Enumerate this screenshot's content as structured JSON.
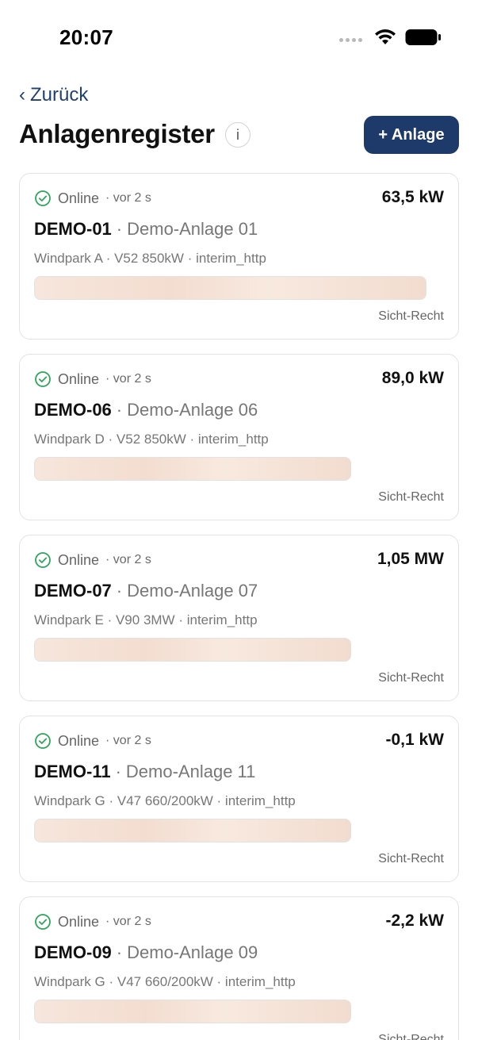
{
  "statusbar": {
    "time": "20:07"
  },
  "nav": {
    "back_label": "Zurück"
  },
  "header": {
    "title": "Anlagenregister",
    "info_label": "i",
    "add_label": "+ Anlage"
  },
  "colors": {
    "accent": "#1d3a6b",
    "back_link": "#1f3f76",
    "online_green": "#2fa55a"
  },
  "plants": [
    {
      "status": "Online",
      "age": "· vor 2 s",
      "power": "63,5 kW",
      "id": "DEMO-01",
      "sep": "·",
      "name": "Demo-Anlage 01",
      "meta": "Windpark A · V52 850kW · interim_http",
      "rights": "Sicht-Recht"
    },
    {
      "status": "Online",
      "age": "· vor 2 s",
      "power": "89,0 kW",
      "id": "DEMO-06",
      "sep": "·",
      "name": "Demo-Anlage 06",
      "meta": "Windpark D · V52 850kW · interim_http",
      "rights": "Sicht-Recht"
    },
    {
      "status": "Online",
      "age": "· vor 2 s",
      "power": "1,05 MW",
      "id": "DEMO-07",
      "sep": "·",
      "name": "Demo-Anlage 07",
      "meta": "Windpark E · V90 3MW · interim_http",
      "rights": "Sicht-Recht"
    },
    {
      "status": "Online",
      "age": "· vor 2 s",
      "power": "-0,1 kW",
      "id": "DEMO-11",
      "sep": "·",
      "name": "Demo-Anlage 11",
      "meta": "Windpark G · V47 660/200kW · interim_http",
      "rights": "Sicht-Recht"
    },
    {
      "status": "Online",
      "age": "· vor 2 s",
      "power": "-2,2 kW",
      "id": "DEMO-09",
      "sep": "·",
      "name": "Demo-Anlage 09",
      "meta": "Windpark G · V47 660/200kW · interim_http",
      "rights": "Sicht-Recht"
    }
  ]
}
